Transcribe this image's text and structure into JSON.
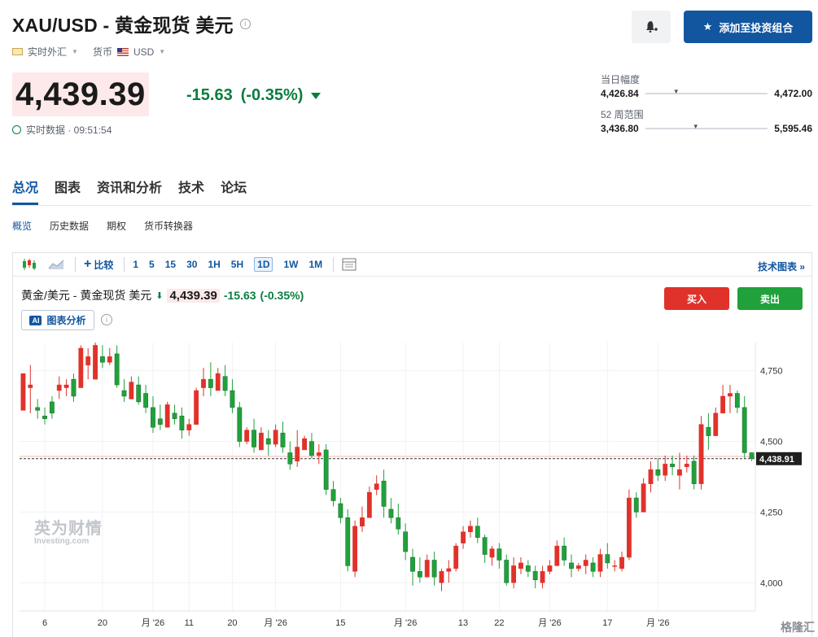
{
  "header": {
    "title": "XAU/USD - 黄金现货 美元",
    "market_type": "实时外汇",
    "currency_label": "货币",
    "currency_value": "USD",
    "add_portfolio_label": "添加至投资组合"
  },
  "quote": {
    "price": "4,439.39",
    "change": "-15.63",
    "change_pct": "(-0.35%)",
    "realtime_label": "实时数据 · 09:51:54"
  },
  "ranges": {
    "day_label": "当日幅度",
    "day_low": "4,426.84",
    "day_high": "4,472.00",
    "week52_label": "52 周范围",
    "week52_low": "3,436.80",
    "week52_high": "5,595.46"
  },
  "tabs": [
    "总况",
    "图表",
    "资讯和分析",
    "技术",
    "论坛"
  ],
  "subtabs": [
    "概览",
    "历史数据",
    "期权",
    "货币转换器"
  ],
  "toolbar": {
    "compare_label": "比较",
    "timeframes": [
      "1",
      "5",
      "15",
      "30",
      "1H",
      "5H",
      "1D",
      "1W",
      "1M"
    ],
    "active_timeframe": "1D",
    "tech_chart_label": "技术图表 »"
  },
  "chart_header": {
    "instrument": "黄金/美元 - 黄金现货 美元",
    "price": "4,439.39",
    "change": "-15.63",
    "change_pct": "(-0.35%)",
    "ai_badge": "AI",
    "ai_label": "图表分析",
    "buy_label": "买入",
    "sell_label": "卖出"
  },
  "watermark": {
    "cn": "英为财情",
    "en": "Investing.com"
  },
  "corner_watermark": "格隆汇",
  "colors": {
    "up": "#e0322a",
    "down": "#20a13b",
    "accent": "#1256a0"
  },
  "chart_data": {
    "type": "candlestick",
    "ylim": [
      3900,
      4850
    ],
    "y_ticks": [
      4000,
      4250,
      4500,
      4750
    ],
    "y_tick_labels": [
      "4,000",
      "4,250",
      "4,500",
      "4,750"
    ],
    "last_price_label": "4,438.91",
    "last_price": 4438.91,
    "x_tick_labels": [
      "6",
      "20",
      "月 '26",
      "11",
      "20",
      "月 '26",
      "15",
      "月 '26",
      "13",
      "22",
      "月 '26",
      "17",
      "月 '26"
    ],
    "x_tick_index": [
      3,
      11,
      18,
      23,
      29,
      35,
      44,
      53,
      61,
      66,
      73,
      81,
      88
    ],
    "candles": [
      [
        4610,
        4720,
        4690,
        4740
      ],
      [
        4690,
        4770,
        4600,
        4700
      ],
      [
        4620,
        4650,
        4580,
        4610
      ],
      [
        4590,
        4620,
        4560,
        4580
      ],
      [
        4640,
        4660,
        4580,
        4600
      ],
      [
        4680,
        4730,
        4650,
        4700
      ],
      [
        4690,
        4720,
        4660,
        4700
      ],
      [
        4720,
        4740,
        4640,
        4660
      ],
      [
        4690,
        4840,
        4730,
        4830
      ],
      [
        4770,
        4830,
        4720,
        4800
      ],
      [
        4720,
        4860,
        4800,
        4840
      ],
      [
        4800,
        4840,
        4760,
        4780
      ],
      [
        4780,
        4830,
        4770,
        4800
      ],
      [
        4810,
        4840,
        4690,
        4700
      ],
      [
        4680,
        4720,
        4640,
        4660
      ],
      [
        4650,
        4730,
        4650,
        4710
      ],
      [
        4700,
        4730,
        4630,
        4640
      ],
      [
        4670,
        4700,
        4600,
        4620
      ],
      [
        4620,
        4660,
        4530,
        4550
      ],
      [
        4580,
        4630,
        4540,
        4560
      ],
      [
        4550,
        4640,
        4590,
        4630
      ],
      [
        4600,
        4630,
        4560,
        4580
      ],
      [
        4590,
        4620,
        4510,
        4540
      ],
      [
        4540,
        4580,
        4520,
        4560
      ],
      [
        4560,
        4690,
        4560,
        4680
      ],
      [
        4690,
        4760,
        4660,
        4720
      ],
      [
        4720,
        4780,
        4660,
        4690
      ],
      [
        4680,
        4760,
        4690,
        4740
      ],
      [
        4730,
        4770,
        4660,
        4680
      ],
      [
        4680,
        4720,
        4600,
        4620
      ],
      [
        4620,
        4640,
        4480,
        4500
      ],
      [
        4500,
        4550,
        4490,
        4540
      ],
      [
        4540,
        4580,
        4460,
        4480
      ],
      [
        4470,
        4550,
        4470,
        4530
      ],
      [
        4510,
        4540,
        4450,
        4490
      ],
      [
        4490,
        4560,
        4480,
        4540
      ],
      [
        4530,
        4570,
        4460,
        4480
      ],
      [
        4460,
        4500,
        4400,
        4420
      ],
      [
        4430,
        4540,
        4410,
        4480
      ],
      [
        4470,
        4520,
        4470,
        4510
      ],
      [
        4500,
        4530,
        4440,
        4450
      ],
      [
        4450,
        4490,
        4420,
        4460
      ],
      [
        4470,
        4490,
        4310,
        4330
      ],
      [
        4330,
        4360,
        4270,
        4290
      ],
      [
        4280,
        4300,
        4210,
        4230
      ],
      [
        4230,
        4260,
        4040,
        4060
      ],
      [
        4040,
        4220,
        4020,
        4200
      ],
      [
        4200,
        4270,
        4180,
        4230
      ],
      [
        4230,
        4340,
        4230,
        4320
      ],
      [
        4330,
        4380,
        4310,
        4350
      ],
      [
        4360,
        4400,
        4230,
        4270
      ],
      [
        4260,
        4300,
        4210,
        4230
      ],
      [
        4230,
        4280,
        4170,
        4190
      ],
      [
        4180,
        4210,
        4080,
        4110
      ],
      [
        4090,
        4120,
        3990,
        4040
      ],
      [
        4040,
        4090,
        4000,
        4020
      ],
      [
        4020,
        4100,
        4020,
        4080
      ],
      [
        4080,
        4110,
        3990,
        4020
      ],
      [
        4000,
        4050,
        3970,
        4040
      ],
      [
        4040,
        4080,
        4000,
        4050
      ],
      [
        4050,
        4140,
        4040,
        4130
      ],
      [
        4140,
        4200,
        4120,
        4180
      ],
      [
        4180,
        4220,
        4160,
        4200
      ],
      [
        4200,
        4230,
        4140,
        4160
      ],
      [
        4160,
        4170,
        4070,
        4100
      ],
      [
        4090,
        4130,
        4060,
        4120
      ],
      [
        4120,
        4140,
        4050,
        4080
      ],
      [
        4080,
        4100,
        3990,
        4000
      ],
      [
        4000,
        4090,
        3980,
        4060
      ],
      [
        4050,
        4090,
        4030,
        4070
      ],
      [
        4060,
        4080,
        4020,
        4040
      ],
      [
        4040,
        4060,
        3980,
        4010
      ],
      [
        4000,
        4060,
        3980,
        4040
      ],
      [
        4040,
        4080,
        4030,
        4060
      ],
      [
        4060,
        4150,
        4060,
        4130
      ],
      [
        4130,
        4160,
        4060,
        4080
      ],
      [
        4070,
        4100,
        4020,
        4050
      ],
      [
        4050,
        4070,
        4040,
        4060
      ],
      [
        4060,
        4100,
        4030,
        4080
      ],
      [
        4070,
        4090,
        4020,
        4040
      ],
      [
        4040,
        4120,
        4020,
        4100
      ],
      [
        4100,
        4140,
        4050,
        4070
      ],
      [
        4060,
        4080,
        4040,
        4060
      ],
      [
        4050,
        4110,
        4040,
        4090
      ],
      [
        4090,
        4330,
        4080,
        4300
      ],
      [
        4300,
        4320,
        4230,
        4250
      ],
      [
        4250,
        4370,
        4250,
        4350
      ],
      [
        4350,
        4430,
        4320,
        4400
      ],
      [
        4400,
        4440,
        4360,
        4380
      ],
      [
        4380,
        4450,
        4360,
        4420
      ],
      [
        4420,
        4450,
        4380,
        4410
      ],
      [
        4380,
        4460,
        4330,
        4400
      ],
      [
        4410,
        4450,
        4390,
        4420
      ],
      [
        4430,
        4450,
        4330,
        4350
      ],
      [
        4350,
        4590,
        4330,
        4560
      ],
      [
        4550,
        4600,
        4470,
        4520
      ],
      [
        4520,
        4620,
        4520,
        4600
      ],
      [
        4600,
        4700,
        4600,
        4660
      ],
      [
        4660,
        4700,
        4600,
        4670
      ],
      [
        4670,
        4680,
        4600,
        4620
      ],
      [
        4620,
        4660,
        4440,
        4460
      ],
      [
        4460,
        4460,
        4430,
        4439
      ]
    ]
  }
}
